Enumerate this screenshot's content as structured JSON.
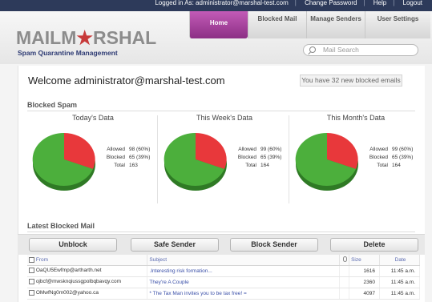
{
  "topbar": {
    "logged_in": "Logged in As: administrator@marshal-test.com",
    "change_password": "Change Password",
    "help": "Help",
    "logout": "Logout"
  },
  "brand": {
    "logo_a": "MAILM",
    "logo_star": "★",
    "logo_b": "RSHAL",
    "tagline": "Spam Quarantine Management"
  },
  "nav": {
    "tabs": [
      {
        "label": "Home"
      },
      {
        "label": "Blocked Mail"
      },
      {
        "label": "Manage Senders"
      },
      {
        "label": "User Settings"
      }
    ]
  },
  "search": {
    "placeholder": "Mail Search"
  },
  "welcome": "Welcome administrator@marshal-test.com",
  "notice": "You have 32 new blocked emails",
  "blocked_spam_title": "Blocked Spam",
  "latest_title": "Latest Blocked Mail",
  "colors": {
    "allowed": "#4caf3c",
    "blocked": "#e8383b",
    "accent": "#b04aa8"
  },
  "charts": [
    {
      "title": "Today's Data",
      "allowed_label": "Allowed",
      "allowed": "98 (60%)",
      "blocked_label": "Blocked",
      "blocked": "65 (39%)",
      "total_label": "Total",
      "total": "163"
    },
    {
      "title": "This Week's Data",
      "allowed_label": "Allowed",
      "allowed": "99 (60%)",
      "blocked_label": "Blocked",
      "blocked": "65 (39%)",
      "total_label": "Total",
      "total": "164"
    },
    {
      "title": "This Month's Data",
      "allowed_label": "Allowed",
      "allowed": "99 (60%)",
      "blocked_label": "Blocked",
      "blocked": "65 (39%)",
      "total_label": "Total",
      "total": "164"
    }
  ],
  "buttons": {
    "unblock": "Unblock",
    "safe_sender": "Safe Sender",
    "block_sender": "Block Sender",
    "delete": "Delete"
  },
  "table": {
    "headers": {
      "from": "From",
      "subject": "Subject",
      "size": "Size",
      "date": "Date"
    },
    "rows": [
      {
        "from": "OaQU5Ewfmp@artharth.net",
        "subject": ".Interesting risk formation...",
        "size": "1616",
        "date": "11:45 a.m."
      },
      {
        "from": "ojbcf@mwsknqiussgpolbqbavqy.com",
        "subject": "They're A Couple",
        "size": "2360",
        "date": "11:45 a.m."
      },
      {
        "from": "OMwfNg0m002@yahoo.ca",
        "subject": "* The Tax Man invites you to be tax free! =",
        "size": "4097",
        "date": "11:45 a.m."
      }
    ]
  }
}
